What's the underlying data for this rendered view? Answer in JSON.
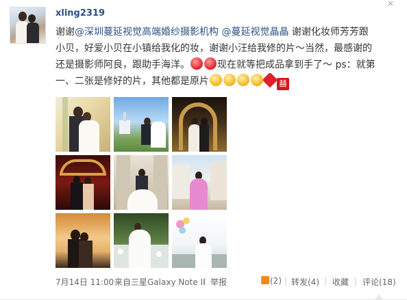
{
  "post": {
    "username": "xling2319",
    "close_icon": "×",
    "text_parts": {
      "p1": "谢谢",
      "m1": "@深圳蔓延视觉高端婚纱摄影机构",
      "m2": "@蔓延视觉晶晶",
      "p2": " 谢谢化妆师芳芳跟小贝，好爱小贝在小镇给我化的妆，谢谢小汪给我修的片～当然，最感谢的还是摄影师阿良，跟助手海洋。",
      "p3": "现在就等把成品拿到手了～ ps：就第一、二张是修好的片，其他都是原片"
    },
    "emoticons": {
      "a": "love-eyes-emoticon",
      "b": "love-eyes-emoticon",
      "c": "laugh-emoticon",
      "d": "smile-emoticon",
      "e": "cry-emoticon",
      "f": "cry-emoticon",
      "g": "heart-emoticon",
      "h": "double-happiness-emoticon",
      "h_glyph": "囍"
    },
    "photos_count": 9
  },
  "footer": {
    "time": "7月14日 11:00",
    "source": "来自三星Galaxy Note II",
    "separator": "|",
    "report": "举报",
    "like_count": "(2)",
    "repost": "转发(4)",
    "favorite": "收藏",
    "comment": "评论(18)"
  },
  "colors": {
    "link": "#2b4f80",
    "text": "#333333",
    "meta": "#666666",
    "like_accent": "#f08a24"
  }
}
